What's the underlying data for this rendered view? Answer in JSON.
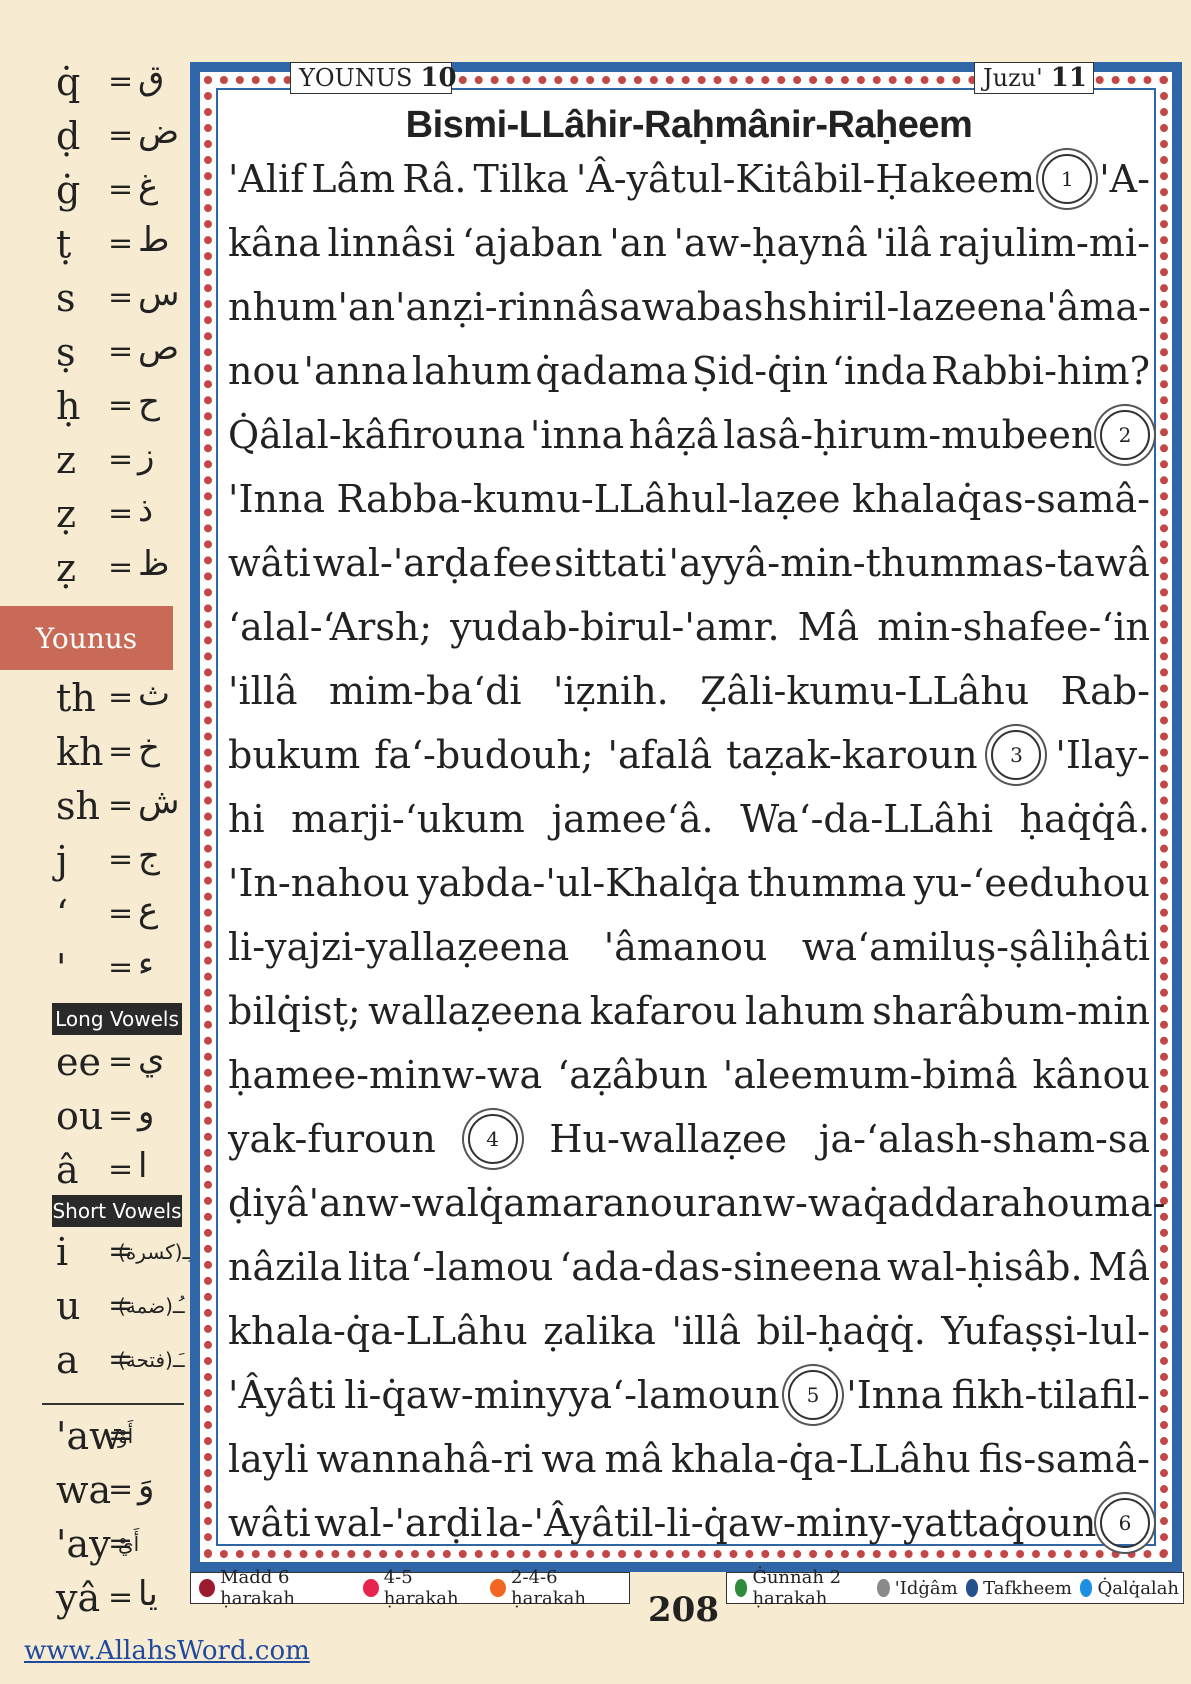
{
  "legend": {
    "consonants_top": [
      {
        "lat": "q̇",
        "ar": "ق"
      },
      {
        "lat": "ḍ",
        "ar": "ض"
      },
      {
        "lat": "ġ",
        "ar": "غ"
      },
      {
        "lat": "ṭ",
        "ar": "ط"
      },
      {
        "lat": "s",
        "ar": "س"
      },
      {
        "lat": "ṣ",
        "ar": "ص"
      },
      {
        "lat": "ḥ",
        "ar": "ح"
      },
      {
        "lat": "z",
        "ar": "ز"
      },
      {
        "lat": "ẓ",
        "ar": "ذ"
      },
      {
        "lat": "ẓ",
        "ar": "ظ"
      }
    ],
    "surah_tab": "Younus",
    "consonants_bottom": [
      {
        "lat": "th",
        "ar": "ث"
      },
      {
        "lat": "kh",
        "ar": "خ"
      },
      {
        "lat": "sh",
        "ar": "ش"
      },
      {
        "lat": "j",
        "ar": "ج"
      },
      {
        "lat": "‘",
        "ar": "ع"
      },
      {
        "lat": "'",
        "ar": "ء"
      }
    ],
    "long_vowels_label": "Long Vowels",
    "long_vowels": [
      {
        "lat": "ee",
        "ar": "ي"
      },
      {
        "lat": "ou",
        "ar": "و"
      },
      {
        "lat": "â",
        "ar": "ا"
      }
    ],
    "short_vowels_label": "Short Vowels",
    "short_vowels": [
      {
        "lat": "i",
        "ar": "ـِـ(كسرة)"
      },
      {
        "lat": "u",
        "ar": "ـُـ(ضمة)"
      },
      {
        "lat": "a",
        "ar": "ـَـ(فتحة)"
      }
    ],
    "diphthongs": [
      {
        "lat": "'aw",
        "ar": "أَوْ"
      },
      {
        "lat": "wa",
        "ar": "وَ"
      },
      {
        "lat": "'ay",
        "ar": "أَيْ"
      },
      {
        "lat": "yâ",
        "ar": "يا"
      }
    ],
    "website": "www.AllahsWord.com"
  },
  "header": {
    "surah_name": "YOUNUS",
    "surah_number": "10",
    "juzu_label": "Juzu'",
    "juzu_number": "11"
  },
  "bismi": "Bismi-LLâhir-Raḥmânir-Raḥeem",
  "lines": [
    [
      "'Alif",
      "Lâm",
      "Râ.",
      "Tilka",
      "'Â-yâtul-Kitâbil-Ḥakeem",
      "(1)",
      "'A-"
    ],
    [
      "kâna",
      "linnâsi",
      "‘ajaban",
      "'an",
      "'aw-ḥaynâ",
      "'ilâ",
      "rajulim-mi-"
    ],
    [
      "nhum",
      "'an",
      "'anẓi-rinnâsa",
      "wa",
      "bashshiril-lazeena",
      "'âma-"
    ],
    [
      "nou",
      "'anna",
      "lahum",
      "q̇adama",
      "Ṣid-q̇in",
      "‘inda",
      "Rabbi-him?"
    ],
    [
      "Q̇âlal-kâfirouna",
      "'inna",
      "hâẓâ",
      "lasâ-ḥirum-mubeen",
      "(2)"
    ],
    [
      "'Inna",
      "Rabba-kumu-LLâhul-laẓee",
      "khalaq̇as-samâ-"
    ],
    [
      "wâti",
      "wal-'arḍa",
      "fee",
      "sittati",
      "'ayyâ-min-thummas-tawâ"
    ],
    [
      "‘alal-‘Arsh;",
      "yudab-birul-'amr.",
      "Mâ",
      "min-shafee-‘in"
    ],
    [
      "'illâ",
      "mim-ba‘di",
      "'iẓnih.",
      "Ẓâli-kumu-LLâhu",
      "Rab-"
    ],
    [
      "bukum",
      "fa‘-budouh;",
      "'afalâ",
      "taẓak-karoun",
      "(3)",
      "'Ilay-"
    ],
    [
      "hi",
      "marji-‘ukum",
      "jamee‘â.",
      "Wa‘-da-LLâhi",
      "ḥaq̇q̇â."
    ],
    [
      "'In-nahou",
      "yabda-'ul-Khalq̇a",
      "thumma",
      "yu-‘eeduhou"
    ],
    [
      "li-yajzi-yallaẓeena",
      "'âmanou",
      "wa‘amiluṣ-ṣâliḥâti"
    ],
    [
      "bilq̇isṭ;",
      "wallaẓeena",
      "kafarou",
      "lahum",
      "sharâbum-min"
    ],
    [
      "ḥamee-minw-wa",
      "‘aẓâbun",
      "'aleemum-bimâ",
      "kânou"
    ],
    [
      "yak-furoun",
      "(4)",
      "Hu-wallaẓee",
      "ja-‘alash-sham-sa"
    ],
    [
      "ḍiyâ'anw-walq̇amara",
      "nouranw-wa",
      "q̇addarahou",
      "ma-"
    ],
    [
      "nâzila",
      "lita‘-lamou",
      "‘ada-das-sineena",
      "wal-ḥisâb.",
      "Mâ"
    ],
    [
      "khala-q̇a-LLâhu",
      "ẓalika",
      "'illâ",
      "bil-ḥaq̇q̇.",
      "Yufaṣṣi-lul-"
    ],
    [
      "'Âyâti",
      "li-q̇aw-minyya‘-lamoun",
      "(5)",
      "'Inna",
      "fikh-tilafil-"
    ],
    [
      "layli",
      "wannahâ-ri",
      "wa",
      "mâ",
      "khala-q̇a-LLâhu",
      "fis-samâ-"
    ],
    [
      "wâti",
      "wal-'arḍi",
      "la-'Âyâtil-li-q̇aw-miny-yattaq̇oun",
      "(6)"
    ]
  ],
  "footer": {
    "left": [
      {
        "label": "Madd 6 ḥarakah",
        "color": "#9c1b2e"
      },
      {
        "label": "4-5 ḥarakah",
        "color": "#e8244e"
      },
      {
        "label": "2-4-6 ḥarakah",
        "color": "#f26522"
      }
    ],
    "right": [
      {
        "label": "Ġunnah 2 ḥarakah",
        "color": "#2f8a3a"
      },
      {
        "label": "'Idġâm",
        "color": "#8a8a8a"
      },
      {
        "label": "Tafkheem",
        "color": "#24508c"
      },
      {
        "label": "Q̇alq̇alah",
        "color": "#1e8fe0"
      }
    ],
    "page_number": "208"
  }
}
